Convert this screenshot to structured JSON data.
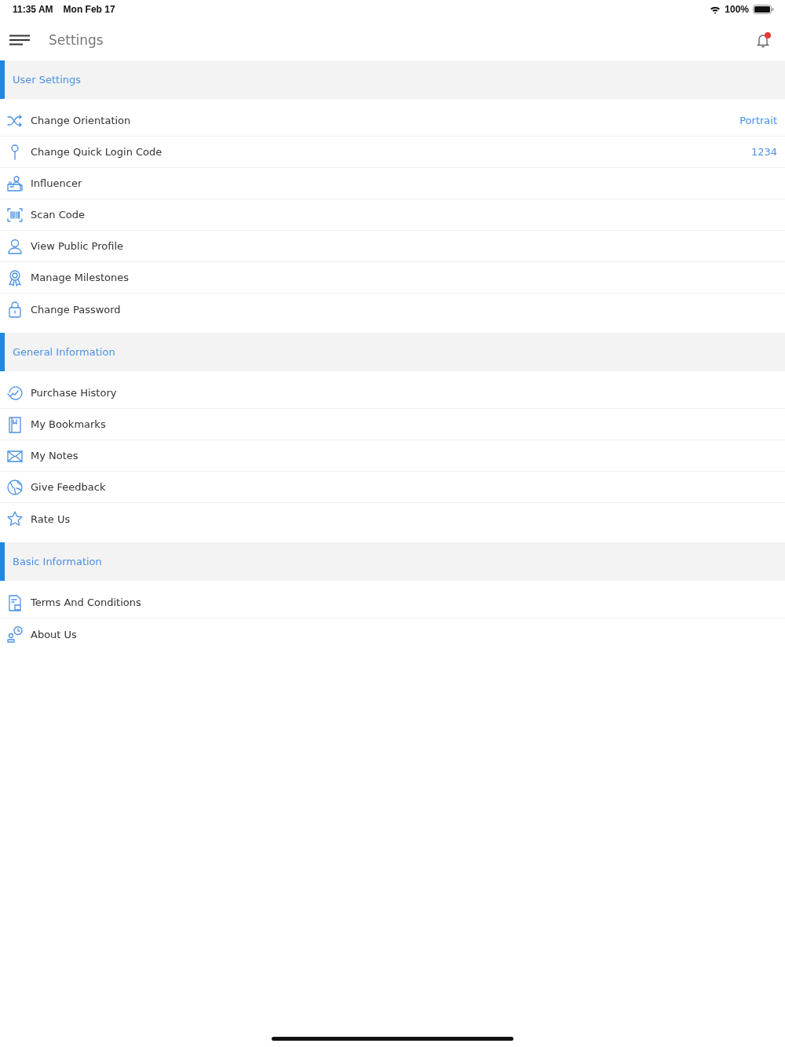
{
  "status_bar": {
    "time": "11:35 AM",
    "date": "Mon Feb 17",
    "battery": "100%"
  },
  "header": {
    "title": "Settings",
    "notification_unread": true
  },
  "sections": [
    {
      "title": "User Settings",
      "items": [
        {
          "label": "Change Orientation",
          "value": "Portrait"
        },
        {
          "label": "Change Quick Login Code",
          "value": "1234"
        },
        {
          "label": "Influencer"
        },
        {
          "label": "Scan Code"
        },
        {
          "label": "View Public Profile"
        },
        {
          "label": "Manage Milestones"
        },
        {
          "label": "Change Password"
        }
      ]
    },
    {
      "title": "General Information",
      "items": [
        {
          "label": "Purchase History"
        },
        {
          "label": "My Bookmarks"
        },
        {
          "label": "My Notes"
        },
        {
          "label": "Give Feedback"
        },
        {
          "label": "Rate Us"
        }
      ]
    },
    {
      "title": "Basic Information",
      "items": [
        {
          "label": "Terms And Conditions"
        },
        {
          "label": "About Us"
        }
      ]
    }
  ]
}
